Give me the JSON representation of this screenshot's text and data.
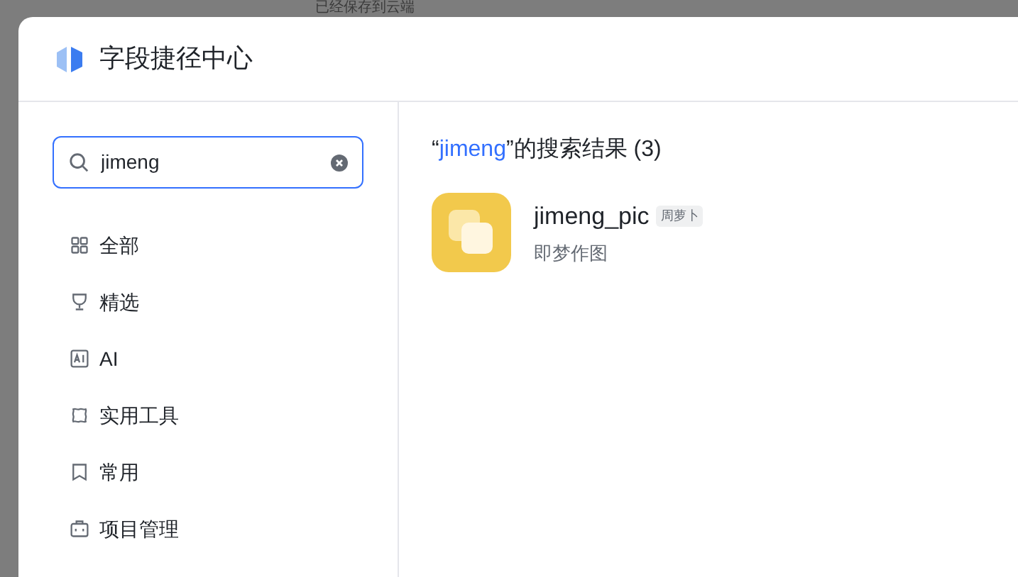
{
  "background": {
    "top_text": "已经保存到云端"
  },
  "dialog": {
    "title": "字段捷径中心"
  },
  "search": {
    "value": "jimeng"
  },
  "categories": [
    {
      "label": "全部",
      "kind": "grid",
      "selected": false
    },
    {
      "label": "精选",
      "kind": "trophy",
      "selected": false
    },
    {
      "label": "AI",
      "kind": "ai",
      "selected": false
    },
    {
      "label": "实用工具",
      "kind": "tools",
      "selected": false
    },
    {
      "label": "常用",
      "kind": "bookmark",
      "selected": false
    },
    {
      "label": "项目管理",
      "kind": "briefcase",
      "selected": false
    }
  ],
  "results": {
    "open_quote": "“",
    "query": "jimeng",
    "suffix": "”的搜索结果 (3)",
    "items": [
      {
        "name": "jimeng_pic",
        "tag": "周萝卜",
        "description": "即梦作图"
      }
    ]
  }
}
